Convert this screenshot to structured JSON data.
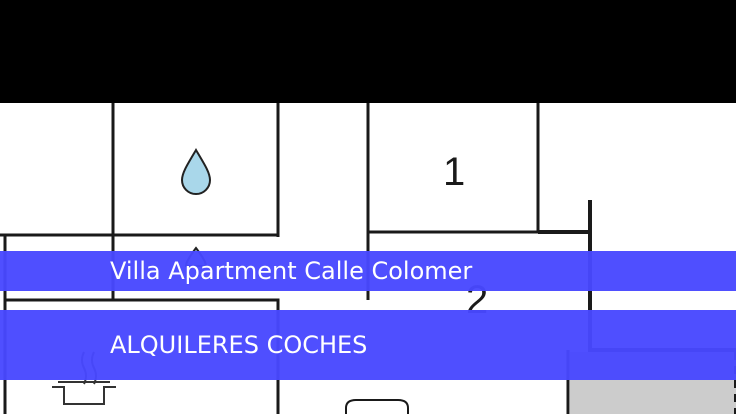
{
  "plan": {
    "room_labels": [
      "1",
      "2"
    ],
    "icons": [
      "water-drop-icon",
      "cooking-pot-icon"
    ]
  },
  "banners": {
    "title": "Villa Apartment Calle Colomer",
    "subtitle": "ALQUILERES COCHES"
  },
  "colors": {
    "banner": "#4848ff",
    "top_bar": "#000000"
  }
}
